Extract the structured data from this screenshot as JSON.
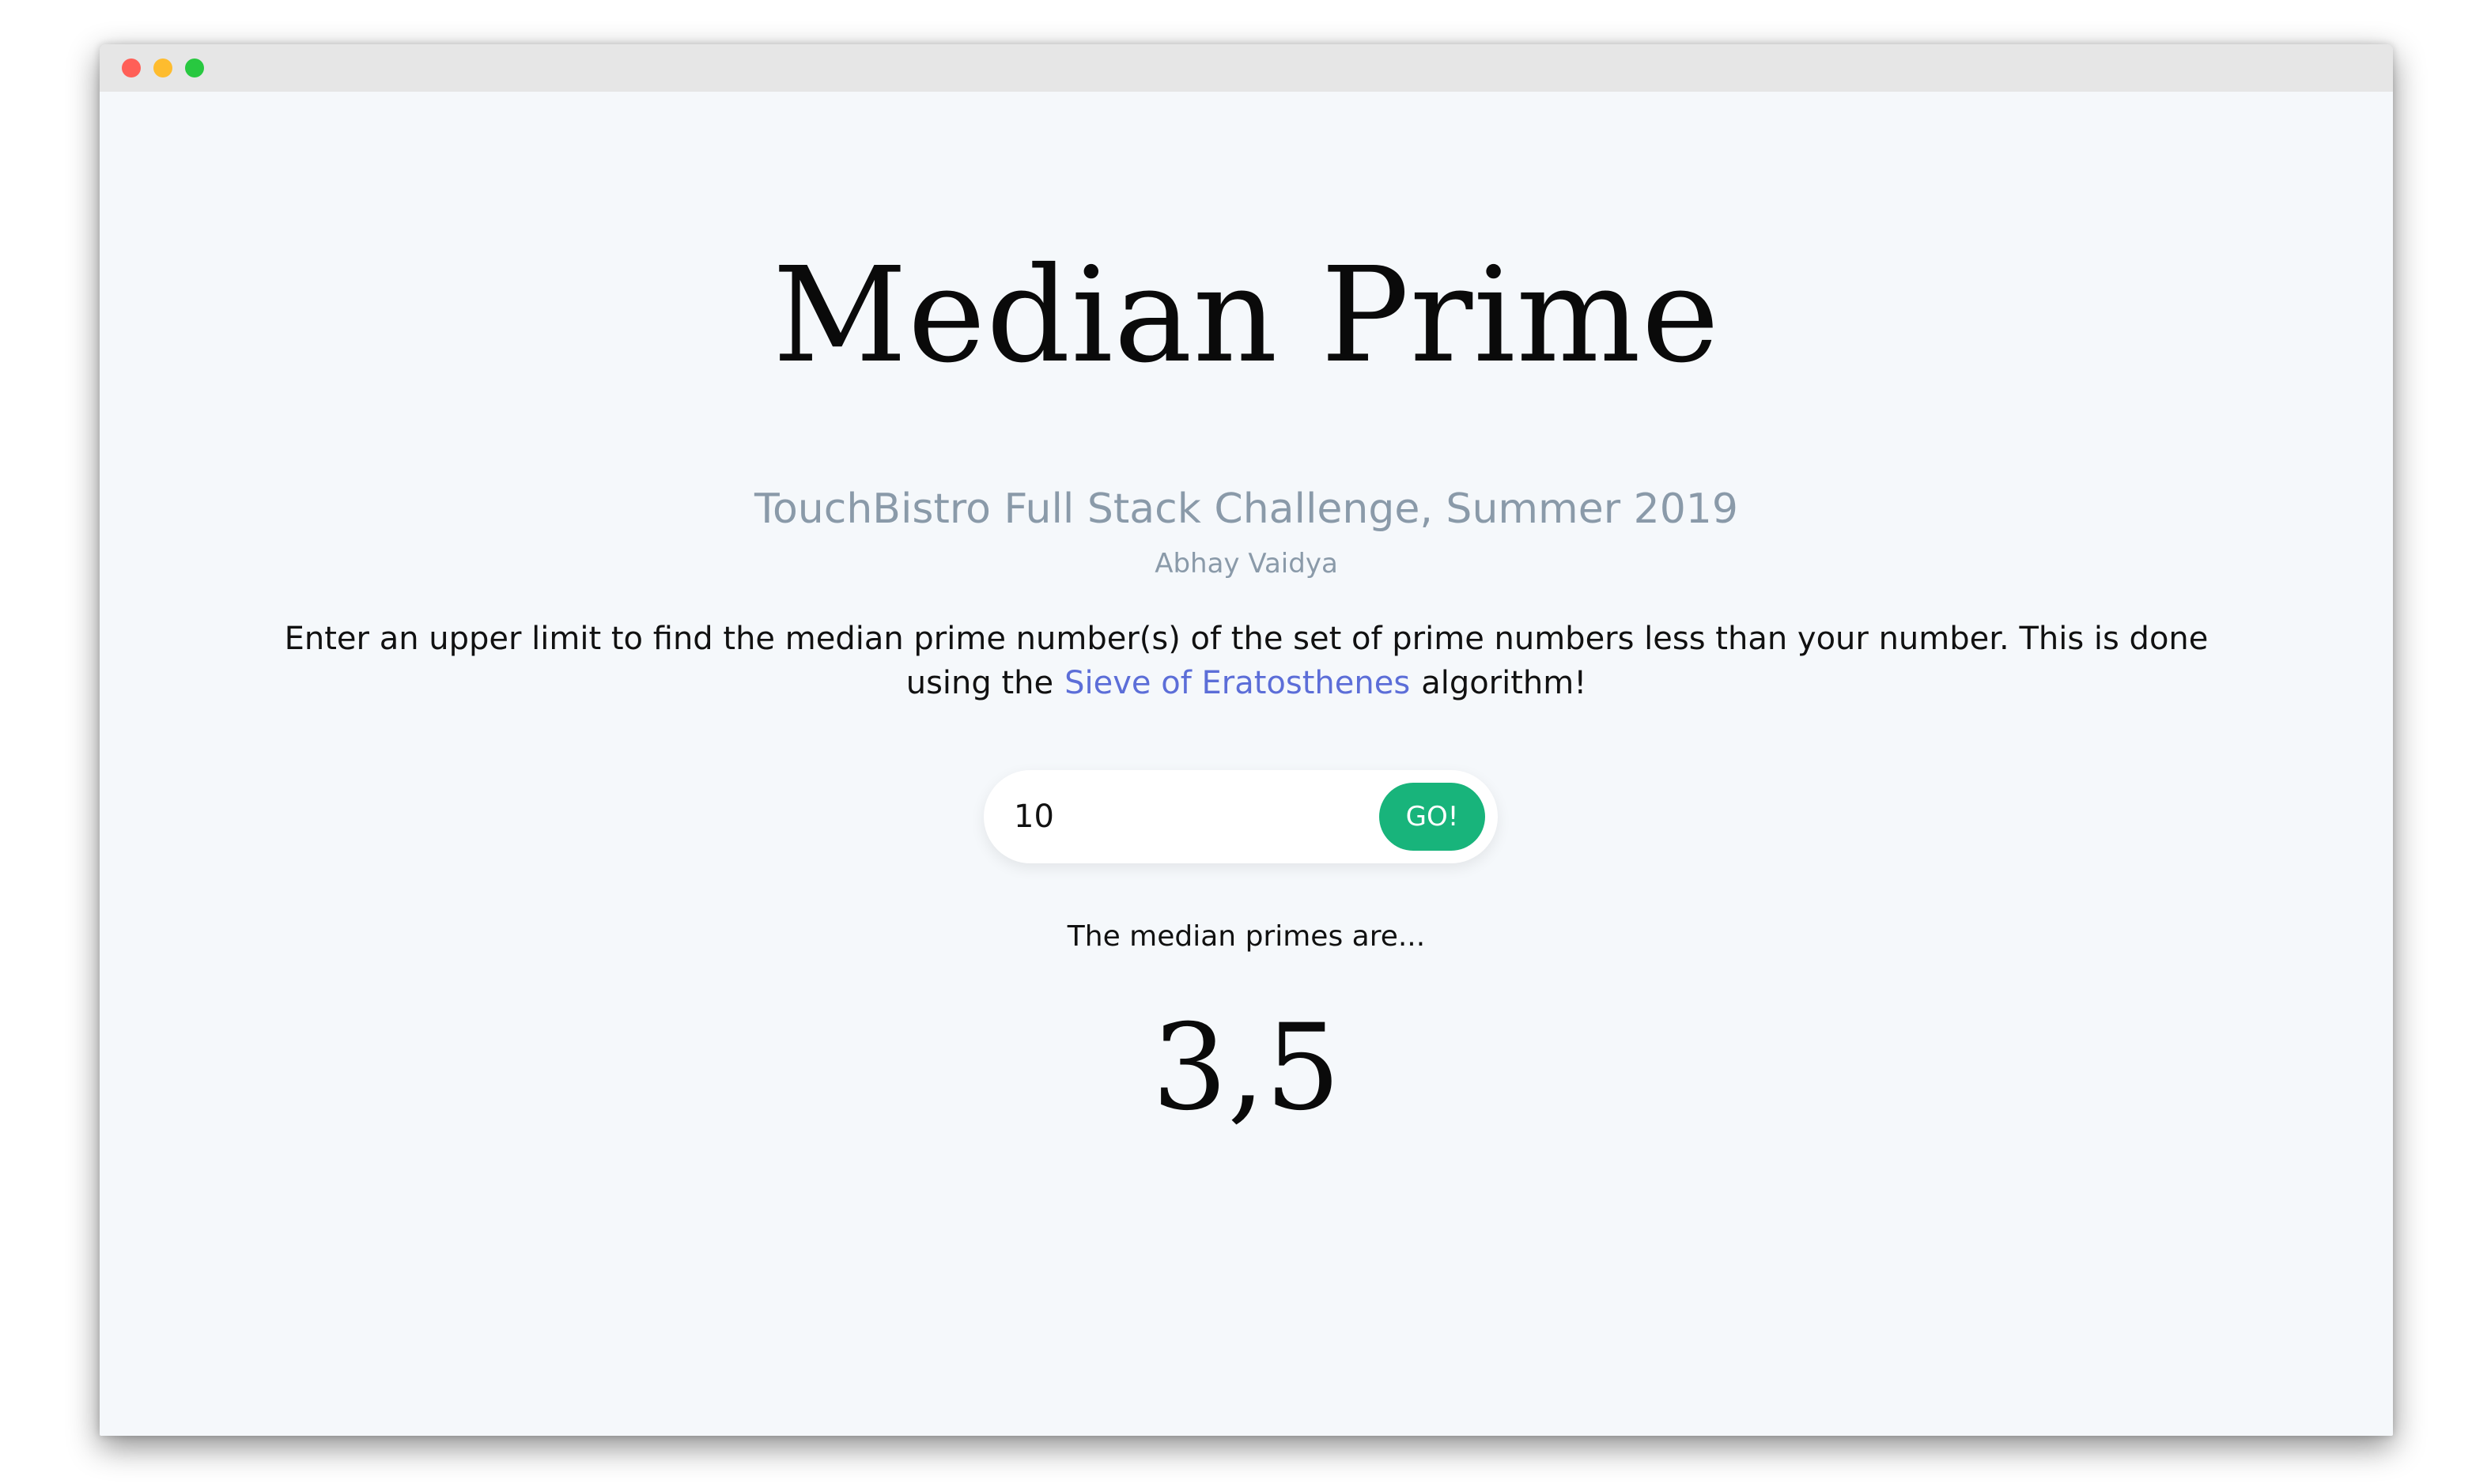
{
  "colors": {
    "traffic_close": "#ff5f57",
    "traffic_minimize": "#febc2e",
    "traffic_zoom": "#28c840",
    "subtitle": "#8a9aa9",
    "link": "#5c6ed8",
    "button": "#18b47b"
  },
  "window": {
    "controls": [
      "close",
      "minimize",
      "zoom"
    ]
  },
  "page": {
    "title": "Median Prime",
    "subtitle": "TouchBistro Full Stack Challenge, Summer 2019",
    "author": "Abhay Vaidya",
    "description_before": "Enter an upper limit to find the median prime number(s) of the set of prime numbers less than your number. This is done using the",
    "description_link": "Sieve of Eratosthenes",
    "description_after": "algorithm!"
  },
  "form": {
    "input_value": "10",
    "button_label": "GO!"
  },
  "result": {
    "label": "The median primes are...",
    "value": "3,5"
  }
}
